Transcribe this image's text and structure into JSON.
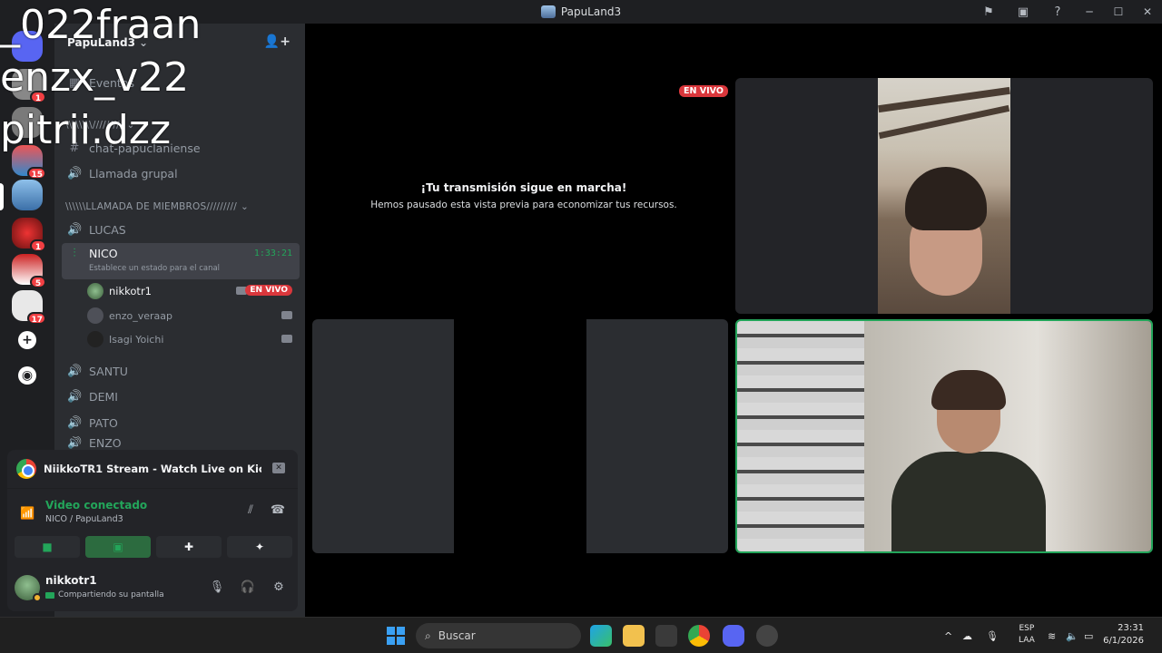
{
  "window": {
    "title": "PapuLand3"
  },
  "overlay_names": [
    "_022fraan",
    "enzx_v22",
    "pitrii.dzz"
  ],
  "rail": {
    "badges": [
      "1",
      "15",
      "1",
      "5",
      "17"
    ]
  },
  "sidebar": {
    "server_name": "PapuLand3",
    "events_label": "Eventos",
    "category_partial": "\\\\\\\\\\\\\\\\/////////",
    "channels_text": [
      {
        "icon": "#",
        "name": "chat-papuclaniense"
      },
      {
        "icon": "speaker",
        "name": "Llamada grupal"
      }
    ],
    "category_members": "\\\\\\\\\\\\LLAMADA DE MIEMBROS/////////",
    "voice_channels": [
      "LUCAS",
      "NICO",
      "SANTU",
      "DEMI",
      "PATO",
      "ENZO"
    ],
    "active_channel": {
      "name": "NICO",
      "timer": "1:33:21",
      "status_hint": "Establece un estado para el canal"
    },
    "members": [
      {
        "name": "nikkotr1",
        "badge": "EN VIVO"
      },
      {
        "name": "enzo_veraap"
      },
      {
        "name": "Isagi Yoichi"
      }
    ]
  },
  "stream_popup": {
    "title": "NiikkoTR1 Stream - Watch Live on Kick -..."
  },
  "voice_panel": {
    "status": "Video conectado",
    "location": "NICO / PapuLand3"
  },
  "user_panel": {
    "username": "nikkotr1",
    "status": "Compartiendo su pantalla"
  },
  "stage": {
    "live_label": "EN VIVO",
    "paused_title": "¡Tu transmisión sigue en marcha!",
    "paused_sub": "Hemos pausado esta vista previa para economizar tus recursos."
  },
  "taskbar": {
    "search_placeholder": "Buscar",
    "lang_top": "ESP",
    "lang_bottom": "LAA",
    "time": "23:31",
    "date": "6/1/2026"
  },
  "colors": {
    "accent_green": "#23a55a",
    "live_red": "#da373c",
    "bg_dark": "#1e1f22",
    "sidebar_bg": "#2b2d31"
  }
}
